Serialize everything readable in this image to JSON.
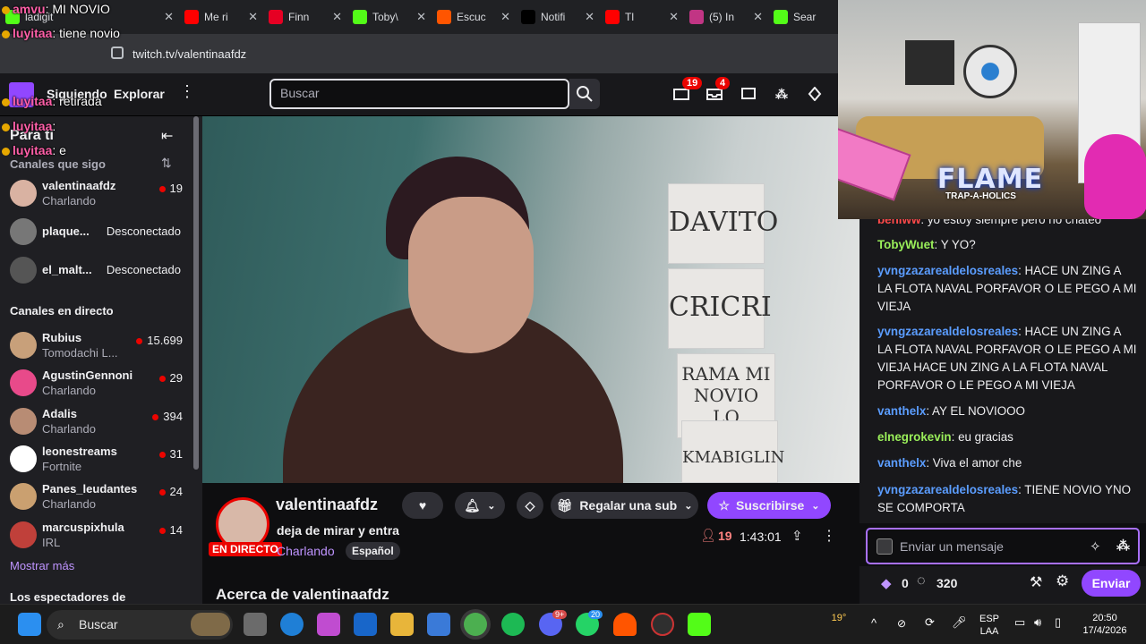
{
  "browser": {
    "tabs": [
      {
        "label": "ladigit",
        "icon": "kick-icon",
        "color": "#53fc18"
      },
      {
        "label": "Me ri",
        "icon": "youtube-icon",
        "color": "#ff0000"
      },
      {
        "label": "Finn",
        "icon": "pinterest-icon",
        "color": "#e60023"
      },
      {
        "label": "Toby\\",
        "icon": "kick-icon",
        "color": "#53fc18"
      },
      {
        "label": "Escuc",
        "icon": "soundcloud-icon",
        "color": "#ff5500"
      },
      {
        "label": "Notifi",
        "icon": "x-icon",
        "color": "#000000"
      },
      {
        "label": "Tl",
        "icon": "youtube-icon",
        "color": "#ff0000"
      },
      {
        "label": "(5) In",
        "icon": "instagram-icon",
        "color": "#c13584"
      },
      {
        "label": "Sear",
        "icon": "kick-icon",
        "color": "#53fc18"
      }
    ],
    "url": "twitch.tv/valentinaafdz"
  },
  "overlay_chat": [
    {
      "nick": "amvu",
      "text": "MI NOVIO"
    },
    {
      "nick": "luyitaa",
      "text": "tiene novio"
    },
    {
      "nick": "luyitaa",
      "text": "retirada"
    },
    {
      "nick": "luyitaa",
      "text": ""
    },
    {
      "nick": "luyitaa",
      "text": "e"
    }
  ],
  "topnav": {
    "following": "Siguiendo",
    "browse": "Explorar",
    "search_placeholder": "Buscar",
    "notif_count": "19",
    "inbox_count": "4"
  },
  "sidebar": {
    "title": "Para ti",
    "followed_header": "Canales que sigo",
    "followed": [
      {
        "name": "valentinaafdz",
        "game": "Charlando",
        "viewers": "19",
        "color": "#d9b2a2"
      },
      {
        "name": "plaque...",
        "status": "Desconectado",
        "color": "#777"
      },
      {
        "name": "el_malt...",
        "status": "Desconectado",
        "color": "#555"
      }
    ],
    "live_header": "Canales en directo",
    "live": [
      {
        "name": "Rubius",
        "game": "Tomodachi L...",
        "viewers": "15.699",
        "color": "#c8a07a"
      },
      {
        "name": "AgustinGennoni",
        "game": "Charlando",
        "viewers": "29",
        "color": "#e84a8a"
      },
      {
        "name": "Adalis",
        "game": "Charlando",
        "viewers": "394",
        "color": "#b88c74"
      },
      {
        "name": "leonestreams",
        "game": "Fortnite",
        "viewers": "31",
        "color": "#ffffff"
      },
      {
        "name": "Panes_leudantes",
        "game": "Charlando",
        "viewers": "24",
        "color": "#caa070"
      },
      {
        "name": "marcuspixhula",
        "game": "IRL",
        "viewers": "14",
        "color": "#c0403a"
      }
    ],
    "show_more": "Mostrar más",
    "viewers_header": "Los espectadores de"
  },
  "video": {
    "papers": [
      "DAVITO",
      "CRICRI",
      "RAMA MI NOVIO LO",
      "KMABIGLIN"
    ]
  },
  "stream": {
    "channel": "valentinaafdz",
    "title": "deja de mirar y entra",
    "category": "Charlando",
    "tag": "Español",
    "live_label": "EN DIRECTO",
    "gift_label": "Regalar una sub",
    "subscribe_label": "Suscribirse",
    "viewers": "19",
    "uptime": "1:43:01",
    "about": "Acerca de valentinaafdz"
  },
  "overlay_brand": {
    "title": "FLAME",
    "subtitle": "TRAP-A-HOLICS"
  },
  "chat": {
    "messages": [
      {
        "user": "beniww",
        "color": "#ff4a4a",
        "text": "yo estoy siempre pero no chateo"
      },
      {
        "user": "TobyWuet",
        "color": "#9aef5a",
        "text": "Y YO?"
      },
      {
        "user": "yvngzazarealdelosreales",
        "color": "#5b9dff",
        "text": "HACE UN ZING A LA FLOTA NAVAL PORFAVOR O LE PEGO A MI VIEJA"
      },
      {
        "user": "yvngzazarealdelosreales",
        "color": "#5b9dff",
        "text": "HACE UN ZING A LA FLOTA NAVAL PORFAVOR O LE PEGO A MI VIEJA HACE UN ZING A LA FLOTA NAVAL PORFAVOR O LE PEGO A MI VIEJA"
      },
      {
        "user": "vanthelx",
        "color": "#5b9dff",
        "text": "AY EL NOVIOOO"
      },
      {
        "user": "elnegrokevin",
        "color": "#9aef5a",
        "text": "eu gracias"
      },
      {
        "user": "vanthelx",
        "color": "#5b9dff",
        "text": "Viva el amor che"
      },
      {
        "user": "yvngzazarealdelosreales",
        "color": "#5b9dff",
        "text": "TIENE NOVIO YNO SE COMPORTA"
      }
    ],
    "input_placeholder": "Enviar un mensaje",
    "bits": "0",
    "points": "320",
    "send_label": "Enviar"
  },
  "taskbar": {
    "search": "Buscar",
    "temperature": "19°",
    "lang_1": "ESP",
    "lang_2": "LAA",
    "time": "20:50",
    "date": "17/4/2026",
    "discord_badge": "9+",
    "whatsapp_badge": "20"
  }
}
